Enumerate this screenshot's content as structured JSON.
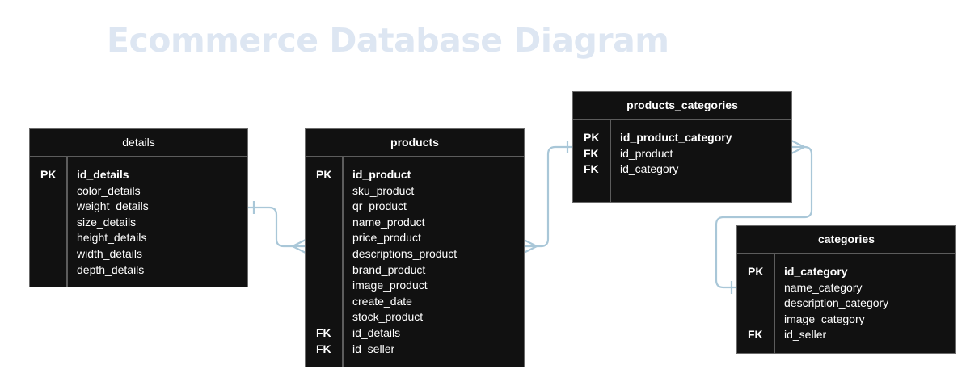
{
  "title": "Ecommerce Database Diagram",
  "colors": {
    "title": "#dde6f2",
    "table_bg": "#111111",
    "connector": "#a9c7d8"
  },
  "tables": {
    "details": {
      "name": "details",
      "columns": [
        {
          "key": "PK",
          "name": "id_details"
        },
        {
          "key": "",
          "name": "color_details"
        },
        {
          "key": "",
          "name": "weight_details"
        },
        {
          "key": "",
          "name": "size_details"
        },
        {
          "key": "",
          "name": "height_details"
        },
        {
          "key": "",
          "name": "width_details"
        },
        {
          "key": "",
          "name": "depth_details"
        }
      ]
    },
    "products": {
      "name": "products",
      "columns": [
        {
          "key": "PK",
          "name": "id_product"
        },
        {
          "key": "",
          "name": "sku_product"
        },
        {
          "key": "",
          "name": "qr_product"
        },
        {
          "key": "",
          "name": "name_product"
        },
        {
          "key": "",
          "name": "price_product"
        },
        {
          "key": "",
          "name": "descriptions_product"
        },
        {
          "key": "",
          "name": "brand_product"
        },
        {
          "key": "",
          "name": "image_product"
        },
        {
          "key": "",
          "name": "create_date"
        },
        {
          "key": "",
          "name": "stock_product"
        },
        {
          "key": "FK",
          "name": "id_details"
        },
        {
          "key": "FK",
          "name": "id_seller"
        }
      ]
    },
    "products_categories": {
      "name": "products_categories",
      "columns": [
        {
          "key": "PK",
          "name": "id_product_category"
        },
        {
          "key": "FK",
          "name": "id_product"
        },
        {
          "key": "FK",
          "name": "id_category"
        }
      ]
    },
    "categories": {
      "name": "categories",
      "columns": [
        {
          "key": "PK",
          "name": "id_category"
        },
        {
          "key": "",
          "name": "name_category"
        },
        {
          "key": "",
          "name": "description_category"
        },
        {
          "key": "",
          "name": "image_category"
        },
        {
          "key": "FK",
          "name": "id_seller"
        }
      ]
    }
  }
}
